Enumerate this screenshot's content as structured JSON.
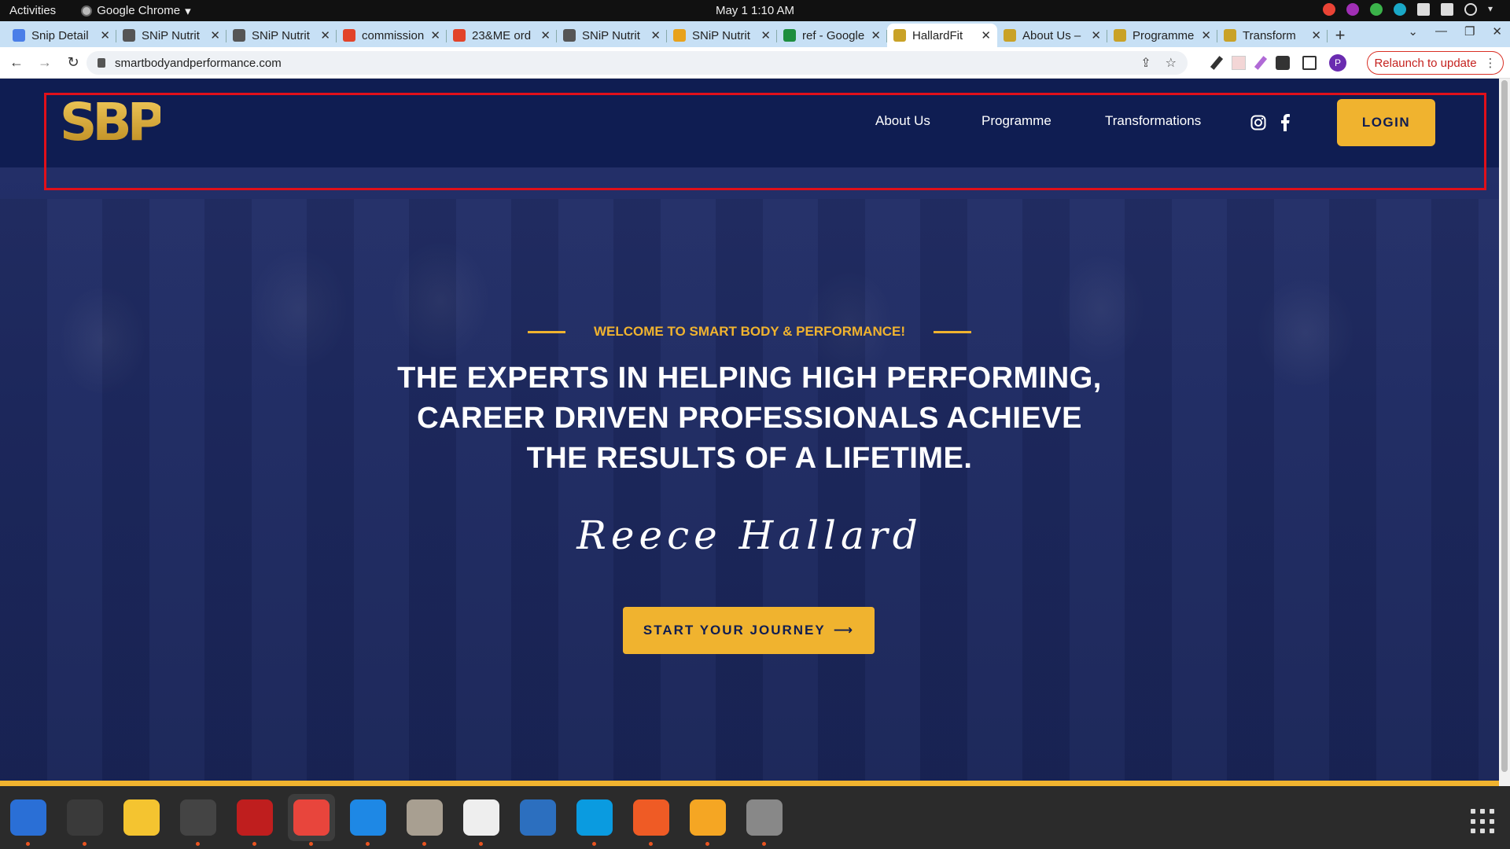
{
  "system": {
    "activities": "Activities",
    "app_name": "Google Chrome",
    "clock": "May 1  1:10 AM"
  },
  "tabs": [
    {
      "title": "Snip Detail",
      "icon": "doc-icon",
      "color": "#4a7ee8"
    },
    {
      "title": "SNiP Nutrit",
      "icon": "snip-icon",
      "color": "#555"
    },
    {
      "title": "SNiP Nutrit",
      "icon": "snip-icon",
      "color": "#555"
    },
    {
      "title": "commission",
      "icon": "gitlab-icon",
      "color": "#e24329"
    },
    {
      "title": "23&ME ord",
      "icon": "gitlab-icon",
      "color": "#e24329"
    },
    {
      "title": "SNiP Nutrit",
      "icon": "snip-icon",
      "color": "#555"
    },
    {
      "title": "SNiP Nutrit",
      "icon": "mail-icon",
      "color": "#e8a21c"
    },
    {
      "title": "ref - Google",
      "icon": "sheets-icon",
      "color": "#1e8e3e"
    },
    {
      "title": "HallardFit",
      "icon": "sbp-icon",
      "color": "#c9a227",
      "active": true
    },
    {
      "title": "About Us –",
      "icon": "sbp-icon",
      "color": "#c9a227"
    },
    {
      "title": "Programme",
      "icon": "sbp-icon",
      "color": "#c9a227"
    },
    {
      "title": "Transform",
      "icon": "sbp-icon",
      "color": "#c9a227"
    }
  ],
  "address": {
    "url": "smartbodyandperformance.com",
    "relaunch": "Relaunch to update",
    "profile_initial": "P"
  },
  "site": {
    "logo_text": "SBP",
    "nav": [
      "About Us",
      "Programme",
      "Transformations"
    ],
    "login": "LOGIN",
    "welcome": "WELCOME TO SMART BODY & PERFORMANCE!",
    "headline_lines": [
      "THE EXPERTS IN HELPING HIGH PERFORMING,",
      "CAREER DRIVEN PROFESSIONALS ACHIEVE",
      "THE RESULTS OF A LIFETIME."
    ],
    "signature": "Reece Hallard",
    "cta": "START YOUR JOURNEY",
    "cta_arrow": "⟶"
  },
  "dock": [
    {
      "name": "thunderbird-icon",
      "color": "#2a6fd6",
      "running": true
    },
    {
      "name": "terminal-icon",
      "color": "#3a3a3a",
      "running": true
    },
    {
      "name": "notes-icon",
      "color": "#f4c430",
      "running": false
    },
    {
      "name": "system-monitor-icon",
      "color": "#444",
      "running": true
    },
    {
      "name": "filezilla-icon",
      "color": "#bf1e1e",
      "running": true
    },
    {
      "name": "chrome-icon",
      "color": "#e8453c",
      "running": true,
      "active": true
    },
    {
      "name": "vscode-icon",
      "color": "#1e88e5",
      "running": true
    },
    {
      "name": "files-icon",
      "color": "#a89f91",
      "running": true
    },
    {
      "name": "text-editor-icon",
      "color": "#eeeeee",
      "running": true
    },
    {
      "name": "document-viewer-icon",
      "color": "#2c6fbf",
      "running": false
    },
    {
      "name": "skype-icon",
      "color": "#0a9be0",
      "running": true
    },
    {
      "name": "postman-icon",
      "color": "#ef5b25",
      "running": true
    },
    {
      "name": "firefox-dev-icon",
      "color": "#f5a623",
      "running": true
    },
    {
      "name": "disk-icon",
      "color": "#888",
      "running": true
    }
  ],
  "colors": {
    "brand_navy": "#0f1d52",
    "brand_gold": "#f0b32f",
    "highlight_red": "#e0101a"
  }
}
